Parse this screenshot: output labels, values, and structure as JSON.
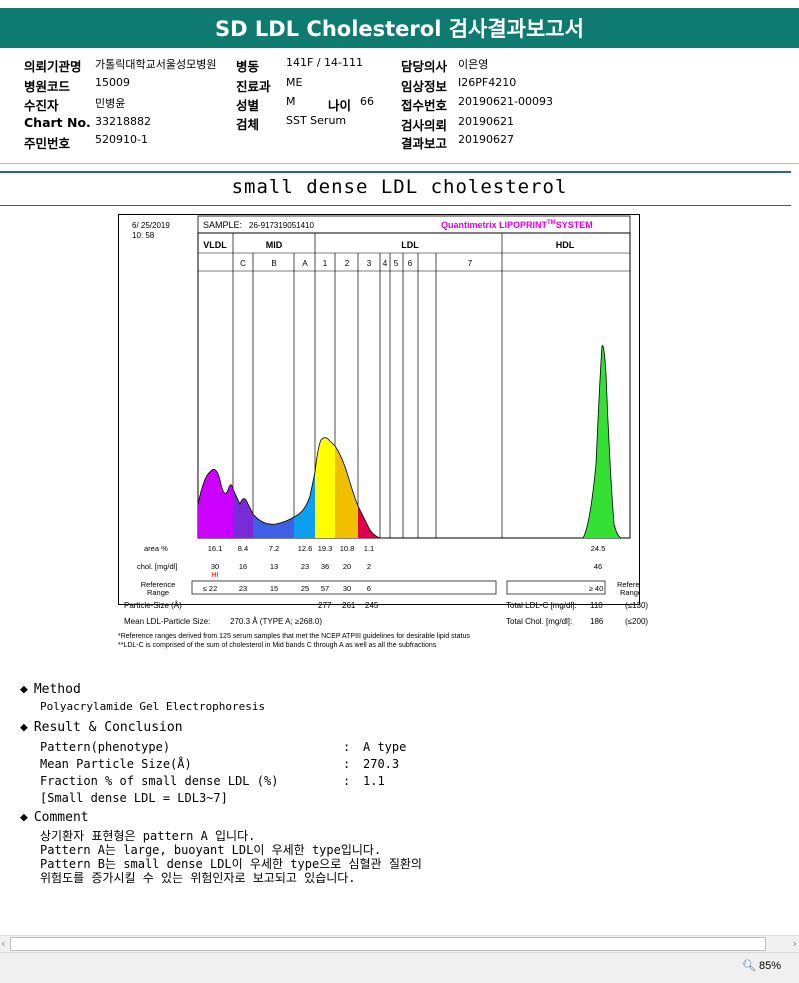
{
  "title": "SD LDL Cholesterol 검사결과보고서",
  "info": {
    "left": [
      {
        "label": "의뢰기관명",
        "value": "가톨릭대학교서울성모병원"
      },
      {
        "label": "병원코드",
        "value": "15009"
      },
      {
        "label": "수진자",
        "value": "민병윤"
      },
      {
        "label": "Chart No.",
        "value": "33218882"
      },
      {
        "label": "주민번호",
        "value": "520910-1"
      }
    ],
    "mid": [
      {
        "label": "병동",
        "value": "141F / 14-111"
      },
      {
        "label": "진료과",
        "value": "ME"
      },
      {
        "label": "성별",
        "value": "M"
      },
      {
        "label": "검체",
        "value": "SST Serum"
      }
    ],
    "age_label": "나이",
    "age_value": "66",
    "right": [
      {
        "label": "담당의사",
        "value": "이은영"
      },
      {
        "label": "임상정보",
        "value": "I26PF4210"
      },
      {
        "label": "접수번호",
        "value": "20190621-00093"
      },
      {
        "label": "검사의뢰",
        "value": "20190621"
      },
      {
        "label": "결과보고",
        "value": "20190627"
      }
    ]
  },
  "section_title": "small dense LDL cholesterol",
  "report": {
    "date": "6/ 25/2019",
    "time": "10: 58",
    "sample_label": "SAMPLE:",
    "sample_id": "26-917319051410",
    "brand": "Quantimetrix LIPOPRINT",
    "brand_tm": "TM",
    "brand_system": "SYSTEM",
    "group_labels": [
      "VLDL",
      "MID",
      "LDL",
      "HDL"
    ],
    "bands": [
      "C",
      "B",
      "A",
      "1",
      "2",
      "3",
      "4",
      "5",
      "6",
      "7"
    ],
    "row_area_label": "area %",
    "area_values": [
      "16.1",
      "8.4",
      "7.2",
      "12.6",
      "19.3",
      "10.8",
      "1.1"
    ],
    "area_hdl": "24.5",
    "row_chol_label": "chol. [mg/dl]",
    "chol_values": [
      "30",
      "16",
      "13",
      "23",
      "36",
      "20",
      "2"
    ],
    "chol_hdl": "46",
    "hi_flag": "HI",
    "ref_label_1": "Reference",
    "ref_label_2": "Range",
    "ref_values": [
      "≤ 22",
      "23",
      "15",
      "25",
      "57",
      "30",
      "6"
    ],
    "ref_hdl": "≥ 40",
    "particle_label": "Particle-Size (Å)",
    "particle_values": [
      "277",
      "261",
      "245"
    ],
    "total_ldl_label": "Total LDL-C [mg/dl]:",
    "total_ldl_value": "110",
    "total_ldl_ref": "(≤130)",
    "mean_label": "Mean LDL-Particle Size:",
    "mean_value": "270.3 Å  (TYPE A; ≥268.0)",
    "total_chol_label": "Total Chol. [mg/dl]:",
    "total_chol_value": "186",
    "total_chol_ref": "(≤200)",
    "colors": {
      "vldl": "#cc00ff",
      "mid_c": "#7a2ad6",
      "mid_b": "#3f5fe6",
      "mid_a": "#0da0f0",
      "ldl1": "#ffff00",
      "ldl2": "#f0c000",
      "ldl3": "#e0004a",
      "hdl": "#33e033",
      "brand": "#e600e6",
      "hi": "#ff0000"
    }
  },
  "footnotes": [
    "*Reference ranges derived from 125 serum samples that met the NCEP ATPIII guidelines for desirable lipid status",
    "**LDL-C is comprised of the sum of cholesterol in Mid bands C through A as well as all the subfractions"
  ],
  "method": {
    "heading": "Method",
    "text": "Polyacrylamide Gel Electrophoresis"
  },
  "result": {
    "heading": "Result & Conclusion",
    "rows": [
      {
        "k": "Pattern(phenotype)",
        "sep": ":",
        "v": "A type"
      },
      {
        "k": "Mean Particle Size(Å)",
        "sep": ":",
        "v": "270.3"
      },
      {
        "k": "Fraction % of small dense LDL (%)",
        "sep": ":",
        "v": "1.1"
      }
    ],
    "note": "[Small dense LDL = LDL3~7]"
  },
  "comment": {
    "heading": "Comment",
    "lines": [
      "상기환자 표현형은 pattern A 입니다.",
      "Pattern A는 large, buoyant LDL이 우세한 type입니다.",
      "Pattern B는 small dense LDL이 우세한 type으로 심혈관 질환의",
      "위험도를 증가시킬 수 있는 위험인자로 보고되고 있습니다."
    ]
  },
  "status": {
    "zoom": "85%",
    "zoom_icon": "magnifier-zoom-icon"
  }
}
